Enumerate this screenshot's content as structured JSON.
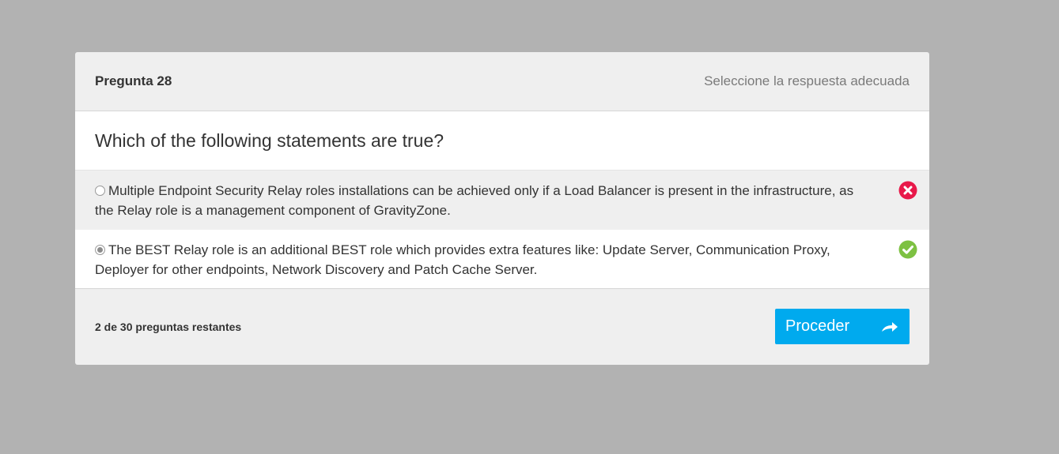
{
  "header": {
    "question_number": "Pregunta 28",
    "instruction": "Seleccione la respuesta adecuada"
  },
  "question": {
    "text": "Which of the following statements are true?"
  },
  "options": [
    {
      "text": "Multiple Endpoint Security Relay roles installations can be achieved only if a Load Balancer is present in the infrastructure, as the Relay role is a management component of GravityZone.",
      "selected": false,
      "status": "incorrect",
      "status_icon": "x-circle-icon",
      "status_color": "#e8194a"
    },
    {
      "text": "The BEST Relay role is an additional BEST role which provides extra features like: Update Server, Communication Proxy, Deployer for other endpoints, Network Discovery and Patch Cache Server.",
      "selected": true,
      "status": "correct",
      "status_icon": "check-circle-icon",
      "status_color": "#7dc142"
    }
  ],
  "footer": {
    "remaining_text": "2 de 30 preguntas restantes",
    "proceed_label": "Proceder",
    "proceed_icon": "share-arrow-icon",
    "proceed_color": "#00aaee"
  }
}
